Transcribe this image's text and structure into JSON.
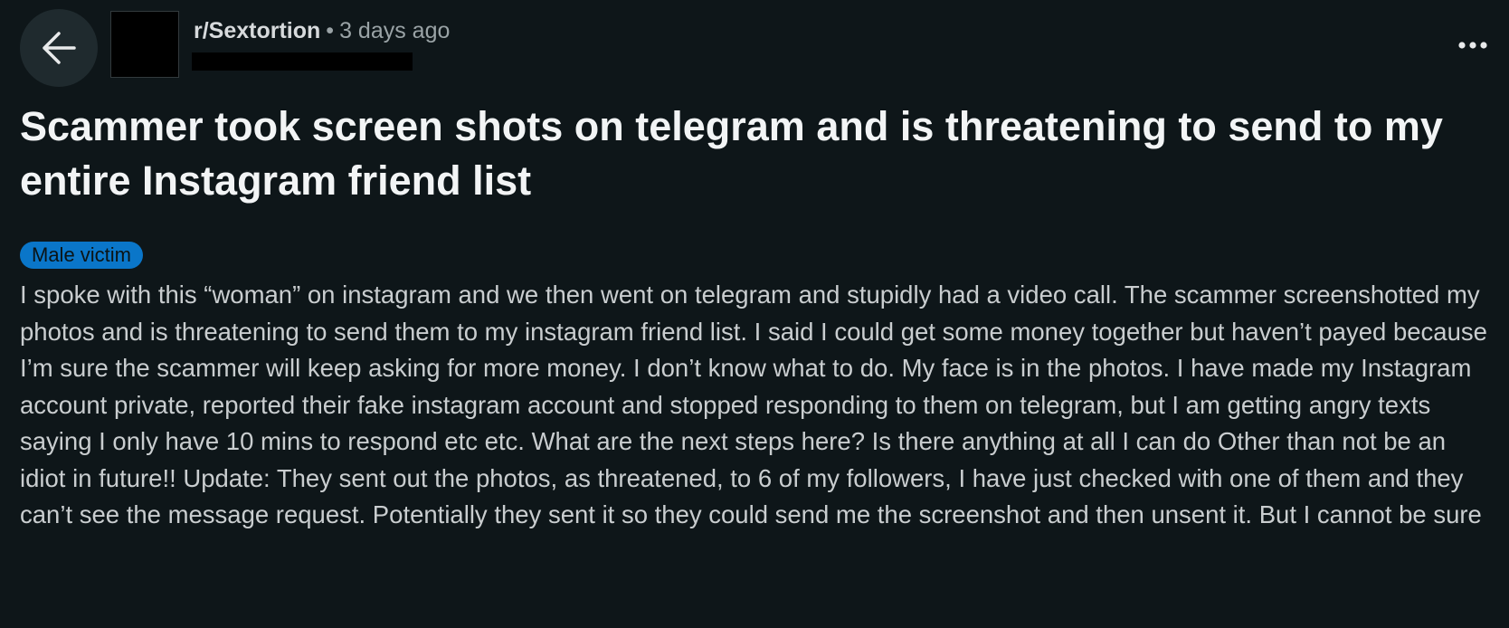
{
  "header": {
    "back_icon": "arrow-left-icon",
    "more_icon": "more-horizontal-icon",
    "subreddit": "r/Sextortion",
    "separator": "•",
    "time_ago": "3 days ago"
  },
  "post": {
    "title": "Scammer took screen shots on telegram and is threatening to send to my entire Instagram friend list",
    "flair": {
      "label": "Male victim",
      "color": "#0a76c9"
    },
    "body": "I spoke with this “woman” on instagram and we then went on telegram and stupidly had a video call. The scammer screenshotted my photos and is threatening to send them to my instagram friend list. I said I could get some money together but haven’t payed because I’m sure the scammer will keep asking for more money. I don’t know what to do. My face is in the photos. I have made my Instagram account private, reported their fake instagram account and stopped responding to them on telegram, but I am getting angry texts saying I only have 10 mins to respond etc etc. What are the next steps here? Is there anything at all I can do Other than not be an idiot in future!! Update: They sent out the photos, as threatened, to 6 of my followers, I have just checked with one of them and they can’t see the message request. Potentially they sent it so they could send me the screenshot and then unsent it. But I cannot be sure"
  },
  "colors": {
    "background": "#0e1619",
    "back_button_bg": "#1f2a2e",
    "text_primary": "#f2f4f5",
    "text_body": "#c9cdcf",
    "text_muted": "#9aa3a6"
  }
}
